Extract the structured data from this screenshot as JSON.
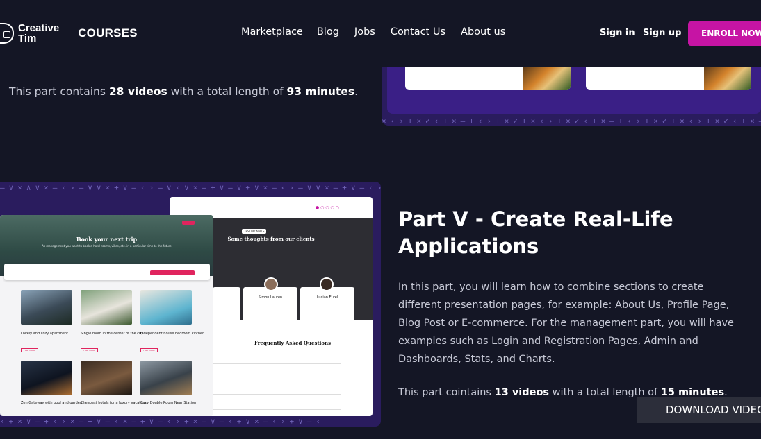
{
  "navbar": {
    "brand_line1": "Creative",
    "brand_line2": "Tim",
    "brand_sub": "COURSES",
    "links": [
      "Marketplace",
      "Blog",
      "Jobs",
      "Contact Us",
      "About us"
    ],
    "sign_in": "Sign in",
    "sign_up": "Sign up",
    "enroll": "ENROLL NOW"
  },
  "part4": {
    "meta_prefix": "This part contains ",
    "videos": "28 videos",
    "meta_mid": " with a total length of ",
    "minutes": "93 minutes",
    "meta_suffix": "."
  },
  "preview": {
    "hero_title": "Book your next trip",
    "hero_sub": "As management you want to book a hotel rooms, villas, etc. in a particular time to the future",
    "testimonials_badge": "TESTIMONIALS",
    "testimonials_title": "Some thoughts from our clients",
    "person2": "Simon Lauren",
    "person3": "Lucian Eurel",
    "faq_title": "Frequently Asked Questions",
    "listing1": "Lovely and cozy apartment",
    "listing2": "Single room in the center of the city",
    "listing3": "Independent house bedroom kitchen",
    "listing4": "Zen Gateway with pool and garden",
    "listing5": "Cheapest hotels for a luxury vacation",
    "listing6": "Cozy Double Room Near Station",
    "more_btn": "FIND MORE"
  },
  "part5": {
    "title": "Part V - Create Real-Life Applications",
    "description": "In this part, you will learn how to combine sections to create different presentation pages, for example: About Us, Profile Page, Blog Post or E-commerce. For the management part, you will have examples such as Login and Registration Pages, Admin and Dashboards, Stats, and Charts.",
    "meta_prefix": "This part cointains ",
    "videos": "13 videos",
    "meta_mid": " with a total length of ",
    "minutes": "15 minutes",
    "meta_suffix": ".",
    "download": "DOWNLOAD VIDEO"
  },
  "colors": {
    "background": "#141625",
    "accent": "#c614a4",
    "banner": "#2a1c5e"
  }
}
